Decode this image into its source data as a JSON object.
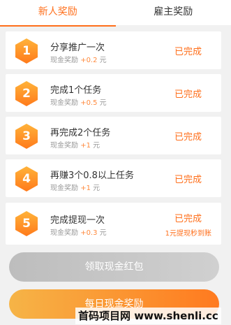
{
  "tabs": {
    "new_user": "新人奖励",
    "employer": "雇主奖励"
  },
  "tasks": [
    {
      "num": "1",
      "title": "分享推广一次",
      "reward_label": "现金奖励",
      "reward_amount": "+0.2",
      "reward_unit": "元",
      "status": "已完成"
    },
    {
      "num": "2",
      "title": "完成1个任务",
      "reward_label": "现金奖励",
      "reward_amount": "+0.5",
      "reward_unit": "元",
      "status": "已完成"
    },
    {
      "num": "3",
      "title": "再完成2个任务",
      "reward_label": "现金奖励",
      "reward_amount": "+1",
      "reward_unit": "元",
      "status": "已完成"
    },
    {
      "num": "4",
      "title": "再赚3个0.8以上任务",
      "reward_label": "现金奖励",
      "reward_amount": "+1",
      "reward_unit": "元",
      "status": "已完成"
    },
    {
      "num": "5",
      "title": "完成提现一次",
      "reward_label": "现金奖励",
      "reward_amount": "+0.3",
      "reward_unit": "元",
      "status": "已完成",
      "note": "1元提现秒到账"
    }
  ],
  "buttons": {
    "claim": "领取现金红包",
    "daily": "每日现金奖励"
  },
  "watermark": "首码项目网 www.shenli.cc",
  "colors": {
    "accent": "#ff6f1b",
    "hex_gradient_start": "#ffb33a",
    "hex_gradient_end": "#ff7a1b"
  }
}
